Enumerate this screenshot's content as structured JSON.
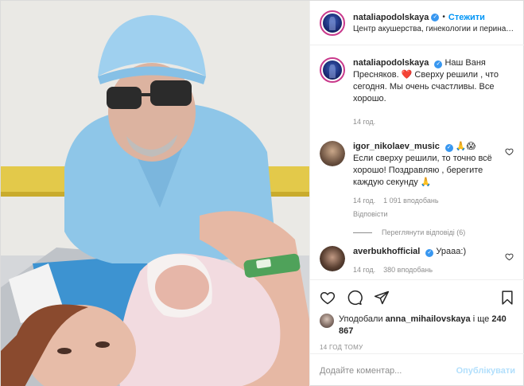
{
  "header": {
    "username": "nataliapodolskaya",
    "follow_label": "Стежити",
    "location": "Центр акушерства, гинекологии и перинато..."
  },
  "caption": {
    "username": "nataliapodolskaya",
    "text": "Наш Ваня Пресняков. ❤️ Сверху решили , что сегодня. Мы очень счастливы. Все хорошо.",
    "time": "14 год."
  },
  "comments": [
    {
      "username": "igor_nikolaev_music",
      "emoji": "🙏😱",
      "text": "Если сверху решили, то точно всё хорошо! Поздравляю , берегите каждую секунду 🙏",
      "time": "14 год.",
      "likes": "1 091 вподобань",
      "reply": "Відповісти",
      "view_replies": "Переглянути відповіді (6)"
    },
    {
      "username": "averbukhofficial",
      "text": "Урааа:)",
      "time": "14 год.",
      "likes": "380 вподобань"
    }
  ],
  "actions": {
    "like_icon": "heart-icon",
    "comment_icon": "comment-icon",
    "share_icon": "paper-plane-icon",
    "save_icon": "bookmark-icon"
  },
  "likes": {
    "prefix": "Уподобали ",
    "user": "anna_mihailovskaya",
    "middle": " і ще ",
    "count": "240 867"
  },
  "post_time": "14 ГОД ТОМУ",
  "add_comment": {
    "placeholder": "Додайте коментар...",
    "publish_label": "Опублікувати"
  },
  "colors": {
    "link_blue": "#0095f6",
    "publish_disabled": "#b2dffc",
    "muted_text": "#8e8e8e",
    "verified_blue": "#3897f0"
  }
}
